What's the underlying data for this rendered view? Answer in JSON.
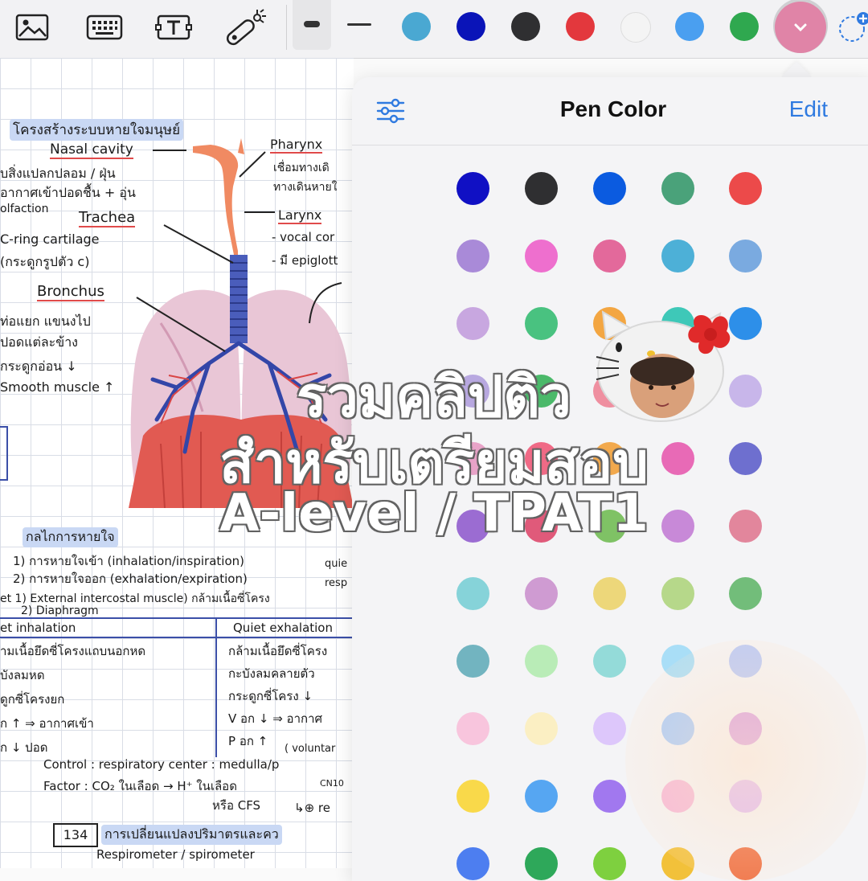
{
  "toolbar": {
    "tools": [
      {
        "name": "image-icon"
      },
      {
        "name": "keyboard-icon"
      },
      {
        "name": "text-box-icon"
      },
      {
        "name": "laser-pointer-icon"
      }
    ],
    "stroke_widths": [
      "thick",
      "thin"
    ],
    "colors": [
      "#4aa8d2",
      "#0a14b8",
      "#2f2f31",
      "#e3383d",
      "#f4f4f4",
      "#4a9ff0",
      "#2fa84f"
    ],
    "selected_color": "#e084a7",
    "selected_icon": "chevron-down-icon",
    "lasso_icon": "lasso-add-icon"
  },
  "popover": {
    "title": "Pen Color",
    "edit_label": "Edit",
    "settings_icon": "sliders-icon",
    "swatches": [
      [
        "#1010c4",
        "#2f2f31",
        "#0b5be0",
        "#4aa27a",
        "#ec4a4a"
      ],
      [
        "#a98ad8",
        "#ee6fce",
        "#e3699b",
        "#4db0d7",
        "#7aaae0"
      ],
      [
        "#c8a7e0",
        "#49c280",
        "#f3a642",
        "#3ec8b8",
        "#2d8fe9"
      ],
      [
        "#b8a8e0",
        "#4bb96a",
        "#ef8fa0",
        "#5ec6cf",
        "#c8b6ea"
      ],
      [
        "#e8a3c8",
        "#f06a86",
        "#f2a94d",
        "#e86ab6",
        "#6e6fcf"
      ],
      [
        "#9b6cd2",
        "#e05a7a",
        "#7fc265",
        "#c889d8",
        "#e2869c"
      ],
      [
        "#86d3d9",
        "#cf9bd2",
        "#edd77a",
        "#b6d88a",
        "#72bd7a"
      ],
      [
        "#72b4c0",
        "#b9ecb7",
        "#94dbd9",
        "#a9def7",
        "#b9c9f7"
      ],
      [
        "#f8c5dd",
        "#fbefc3",
        "#ddc7fb",
        "#a8cbfa",
        "#d89ee1"
      ],
      [
        "#f9d94a",
        "#56a6f2",
        "#a178ef",
        "#f5b7d8",
        "#dfbaf4"
      ],
      [
        "#4d7ef0",
        "#2ea85a",
        "#7ed03f",
        "#f2c13a",
        "#ee6a3c"
      ]
    ]
  },
  "notebook": {
    "title_heading": "โครงสร้างระบบหายใจมนุษย์",
    "nasal_label": "Nasal cavity",
    "nasal_note1": "บสิ่งแปลกปลอม / ฝุ่น",
    "nasal_note2": "อากาศเข้าปอดชื้น + อุ่น",
    "nasal_note3": "olfaction",
    "trachea_label": "Trachea",
    "trachea_note1": "C-ring cartilage",
    "trachea_note2": "(กระดูกรูปตัว c)",
    "bronchus_label": "Bronchus",
    "bronchus_note1": "ท่อแยก แขนงไป",
    "bronchus_note2": "ปอดแต่ละข้าง",
    "bronchus_note3": "กระดูกอ่อน ↓",
    "bronchus_note4": "Smooth muscle ↑",
    "pharynx_label": "Pharynx",
    "pharynx_note1": "เชื่อมทางเดิ",
    "pharynx_note2": "ทางเดินหายใ",
    "larynx_label": "Larynx",
    "larynx_note1": "- vocal cor",
    "larynx_note2": "- มี epiglott",
    "mech_heading": "กลไกการหายใจ",
    "mech_item1": "1) การหายใจเข้า (inhalation/inspiration)",
    "mech_item2": "2) การหายใจออก (exhalation/expiration)",
    "mech_quiet": "quie",
    "mech_resp": "resp",
    "muscle_line": "et  1) External intercostal muscle) กล้ามเนื้อซี่โครง",
    "muscle_line2": "2) Diaphragm",
    "table_head_left": "et inhalation",
    "table_head_right": "Quiet exhalation",
    "left_rows": [
      "ามเนื้อยึดซี่โครงแถบนอกหด",
      "บังลมหด",
      "ดูกซี่โครงยก",
      "ก ↑  ⇒ อากาศเข้า",
      "ก ↓       ปอด"
    ],
    "right_rows": [
      "กล้ามเนื้อยึดซี่โครง",
      "กะบังลมคลายตัว",
      "กระดูกซี่โครง ↓",
      "V อก ↓  ⇒ อากาศ",
      "P อก ↑"
    ],
    "voluntary": "( voluntar",
    "control": "Control :  respiratory center : medulla/p",
    "factor": "Factor :  CO₂ ในเลือด → H⁺ ในเลือด",
    "cn": "CN10",
    "or_cfs": "หรือ CFS",
    "res": "↳⊕ re",
    "page_number": "134",
    "page_heading": "การเปลี่ยนแปลงปริมาตรและคว",
    "respirometer": "Respirometer / spirometer"
  },
  "overlay": {
    "line1": "รวมคลิปติว",
    "line2": "สำหรับเตรียมสอบ",
    "line3": "A-level / TPAT1"
  }
}
